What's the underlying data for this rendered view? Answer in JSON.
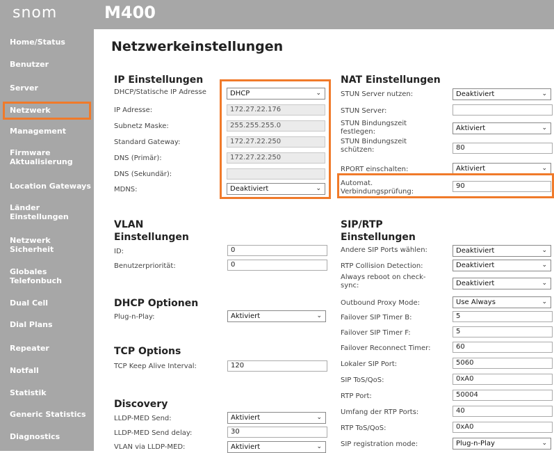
{
  "header": {
    "logo": "snom",
    "model": "M400"
  },
  "sidebar": {
    "items": [
      {
        "label": "Home/Status"
      },
      {
        "label": "Benutzer"
      },
      {
        "label": "Server"
      },
      {
        "label": "Netzwerk"
      },
      {
        "label": "Management"
      },
      {
        "label": "Firmware Aktualisierung"
      },
      {
        "label": "Location Gateways"
      },
      {
        "label": "Länder Einstellungen"
      },
      {
        "label": "Netzwerk Sicherheit"
      },
      {
        "label": "Globales Telefonbuch"
      },
      {
        "label": "Dual Cell"
      },
      {
        "label": "Dial Plans"
      },
      {
        "label": "Repeater"
      },
      {
        "label": "Notfall"
      },
      {
        "label": "Statistik"
      },
      {
        "label": "Generic Statistics"
      },
      {
        "label": "Diagnostics"
      }
    ],
    "active": "Netzwerk"
  },
  "page": {
    "title": "Netzwerkeinstellungen"
  },
  "ip": {
    "title": "IP Einstellungen",
    "dhcp_label": "DHCP/Statische IP Adresse",
    "dhcp_value": "DHCP",
    "ip_label": "IP Adresse:",
    "ip_value": "172.27.22.176",
    "mask_label": "Subnetz Maske:",
    "mask_value": "255.255.255.0",
    "gw_label": "Standard Gateway:",
    "gw_value": "172.27.22.250",
    "dns1_label": "DNS (Primär):",
    "dns1_value": "172.27.22.250",
    "dns2_label": "DNS (Sekundär):",
    "dns2_value": "",
    "mdns_label": "MDNS:",
    "mdns_value": "Deaktiviert"
  },
  "nat": {
    "title": "NAT Einstellungen",
    "stun_use_label": "STUN Server nutzen:",
    "stun_use_value": "Deaktiviert",
    "stun_server_label": "STUN Server:",
    "stun_server_value": "",
    "stun_bind_label_1": "STUN Bindungszeit",
    "stun_bind_label_2": "festlegen:",
    "stun_bind_value": "Aktiviert",
    "stun_protect_label_1": "STUN Bindungszeit",
    "stun_protect_label_2": "schützen:",
    "stun_protect_value": "80",
    "rport_label": "RPORT einschalten:",
    "rport_value": "Aktiviert",
    "auto_label_1": "Automat.",
    "auto_label_2": "Verbindungsprüfung:",
    "auto_value": "90"
  },
  "vlan": {
    "title_1": "VLAN",
    "title_2": "Einstellungen",
    "id_label": "ID:",
    "id_value": "0",
    "prio_label": "Benutzerpriorität:",
    "prio_value": "0"
  },
  "dhcp_opt": {
    "title": "DHCP Optionen",
    "pnp_label": "Plug-n-Play:",
    "pnp_value": "Aktiviert"
  },
  "tcp": {
    "title": "TCP Options",
    "keepalive_label": "TCP Keep Alive Interval:",
    "keepalive_value": "120"
  },
  "discovery": {
    "title": "Discovery",
    "lldp_send_label": "LLDP-MED Send:",
    "lldp_send_value": "Aktiviert",
    "lldp_delay_label": "LLDP-MED Send delay:",
    "lldp_delay_value": "30",
    "vlan_lldp_label": "VLAN via LLDP-MED:",
    "vlan_lldp_value": "Aktiviert"
  },
  "sip": {
    "title_1": "SIP/RTP",
    "title_2": "Einstellungen",
    "other_ports_label": "Andere SIP Ports wählen:",
    "other_ports_value": "Deaktiviert",
    "rtp_collision_label": "RTP Collision Detection:",
    "rtp_collision_value": "Deaktiviert",
    "always_reboot_label_1": "Always reboot on check-",
    "always_reboot_label_2": "sync:",
    "always_reboot_value": "Deaktiviert",
    "outbound_label": "Outbound Proxy Mode:",
    "outbound_value": "Use Always",
    "timer_b_label": "Failover SIP Timer B:",
    "timer_b_value": "5",
    "timer_f_label": "Failover SIP Timer F:",
    "timer_f_value": "5",
    "reconnect_label": "Failover Reconnect Timer:",
    "reconnect_value": "60",
    "local_port_label": "Lokaler SIP Port:",
    "local_port_value": "5060",
    "sip_tos_label": "SIP ToS/QoS:",
    "sip_tos_value": "0xA0",
    "rtp_port_label": "RTP Port:",
    "rtp_port_value": "50004",
    "rtp_range_label": "Umfang der RTP Ports:",
    "rtp_range_value": "40",
    "rtp_tos_label": "RTP ToS/QoS:",
    "rtp_tos_value": "0xA0",
    "reg_mode_label": "SIP registration mode:",
    "reg_mode_value": "Plug-n-Play"
  },
  "colors": {
    "sidebar": "#a7a7a7",
    "highlight": "#f07a2a"
  }
}
